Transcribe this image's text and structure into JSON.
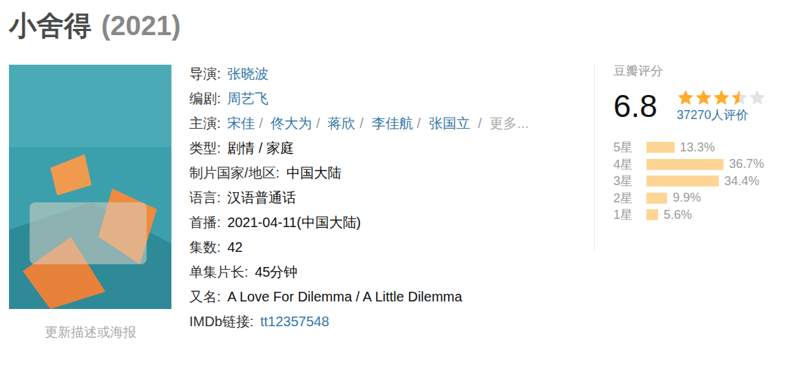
{
  "title": "小舍得",
  "year": "(2021)",
  "poster": {
    "link": "更新描述或海报"
  },
  "separator": "/",
  "info": [
    {
      "label": "导演:",
      "kind": "links",
      "links": [
        "张晓波"
      ]
    },
    {
      "label": "编剧:",
      "kind": "links",
      "links": [
        "周艺飞"
      ]
    },
    {
      "label": "主演:",
      "kind": "links",
      "links": [
        "宋佳",
        "佟大为",
        "蒋欣",
        "李佳航",
        "张国立"
      ],
      "more": "更多..."
    },
    {
      "label": "类型:",
      "kind": "text",
      "text": "剧情 / 家庭"
    },
    {
      "label": "制片国家/地区:",
      "kind": "text",
      "text": "中国大陆"
    },
    {
      "label": "语言:",
      "kind": "text",
      "text": "汉语普通话"
    },
    {
      "label": "首播:",
      "kind": "text",
      "text": "2021-04-11(中国大陆)"
    },
    {
      "label": "集数:",
      "kind": "text",
      "text": "42"
    },
    {
      "label": "单集片长:",
      "kind": "text",
      "text": "45分钟"
    },
    {
      "label": "又名:",
      "kind": "text",
      "text": "A Love For Dilemma / A Little Dilemma"
    },
    {
      "label": "IMDb链接:",
      "kind": "links",
      "links": [
        "tt12357548"
      ]
    }
  ],
  "rating": {
    "label": "豆瓣评分",
    "score": "6.8",
    "stars": 3.5,
    "votes": "37270人评价",
    "histogram": [
      {
        "label": "5星",
        "level": 0.133,
        "percent": "13.3%"
      },
      {
        "label": "4星",
        "level": 0.367,
        "percent": "36.7%"
      },
      {
        "label": "3星",
        "level": 0.344,
        "percent": "34.4%"
      },
      {
        "label": "2星",
        "level": 0.099,
        "percent": "9.9%"
      },
      {
        "label": "1星",
        "level": 0.056,
        "percent": "5.6%"
      }
    ]
  }
}
